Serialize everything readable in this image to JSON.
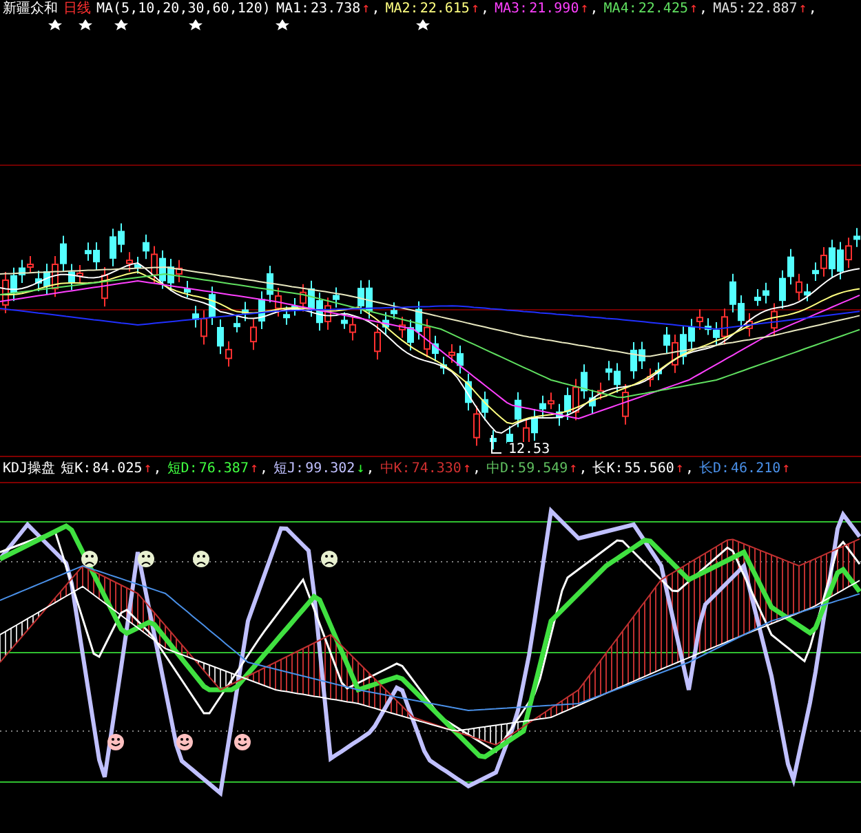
{
  "main_panel": {
    "title": "新疆众和",
    "period": "日线",
    "indicator": "MA(5,10,20,30,60,120)",
    "readings": [
      {
        "label": "MA1:",
        "value": "23.738",
        "arrow": {
          "text": "↑",
          "color": "#ff3030"
        },
        "separator": ",",
        "color": "#ffffff"
      },
      {
        "label": "MA2:",
        "value": "22.615",
        "arrow": {
          "text": "↑",
          "color": "#ff3030"
        },
        "separator": ",",
        "color": "#ffff80"
      },
      {
        "label": "MA3:",
        "value": "21.990",
        "arrow": {
          "text": "↑",
          "color": "#ff3030"
        },
        "separator": ",",
        "color": "#ff40ff"
      },
      {
        "label": "MA4:",
        "value": "22.425",
        "arrow": {
          "text": "↑",
          "color": "#ff3030"
        },
        "separator": ",",
        "color": "#60e060"
      },
      {
        "label": "MA5:",
        "value": "22.887",
        "arrow": {
          "text": "↑",
          "color": "#ff3030"
        },
        "separator": ",",
        "color": "#e0e0e0"
      }
    ],
    "low_label": "12.53"
  },
  "kdj_panel": {
    "title": "KDJ操盘",
    "readings": [
      {
        "label": "短K:",
        "value": "84.025",
        "arrow": {
          "text": "↑",
          "color": "#ff3030"
        },
        "separator": ",",
        "color": "#ffffff"
      },
      {
        "label": "短D:",
        "value": "76.387",
        "arrow": {
          "text": "↑",
          "color": "#ff3030"
        },
        "separator": ",",
        "color": "#40ff40"
      },
      {
        "label": "短J:",
        "value": "99.302",
        "arrow": {
          "text": "↓",
          "color": "#30ff30"
        },
        "separator": ",",
        "color": "#c0c0ff"
      },
      {
        "label": "中K:",
        "value": "74.330",
        "arrow": {
          "text": "↑",
          "color": "#ff3030"
        },
        "separator": ",",
        "color": "#d03030"
      },
      {
        "label": "中D:",
        "value": "59.549",
        "arrow": {
          "text": "↑",
          "color": "#ff3030"
        },
        "separator": ",",
        "color": "#60c060"
      },
      {
        "label": "长K:",
        "value": "55.560",
        "arrow": {
          "text": "↑",
          "color": "#ff3030"
        },
        "separator": ",",
        "color": "#ffffff"
      },
      {
        "label": "长D:",
        "value": "46.210",
        "arrow": {
          "text": "↑",
          "color": "#ff3030"
        },
        "color": "#4a90e8"
      }
    ]
  }
}
